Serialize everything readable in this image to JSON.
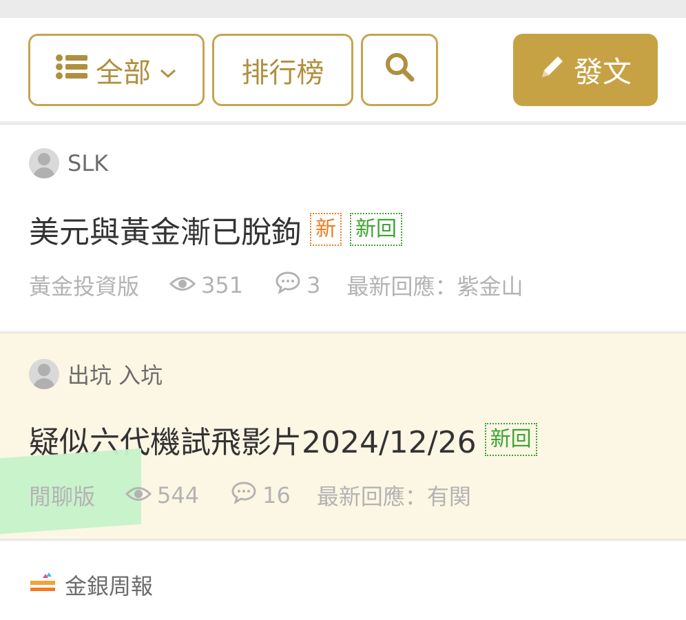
{
  "toolbar": {
    "all_label": "全部",
    "rank_label": "排行榜",
    "post_label": "發文"
  },
  "posts": [
    {
      "author": "SLK",
      "title": "美元與黃金漸已脫鉤",
      "tags": [
        "新",
        "新回"
      ],
      "board": "黃金投資版",
      "views": "351",
      "comments": "3",
      "latest_reply": "最新回應：紫金山"
    },
    {
      "author": "出坑 入坑",
      "title": "疑似六代機試飛影片2024/12/26",
      "tags": [
        "新回"
      ],
      "board": "閒聊版",
      "views": "544",
      "comments": "16",
      "latest_reply": "最新回應：有関"
    },
    {
      "author": "金銀周報"
    }
  ],
  "colors": {
    "accent": "#c6a245",
    "tag_new": "#ef7a1b",
    "tag_reply": "#3da332",
    "highlight": "#c6f2c9"
  }
}
